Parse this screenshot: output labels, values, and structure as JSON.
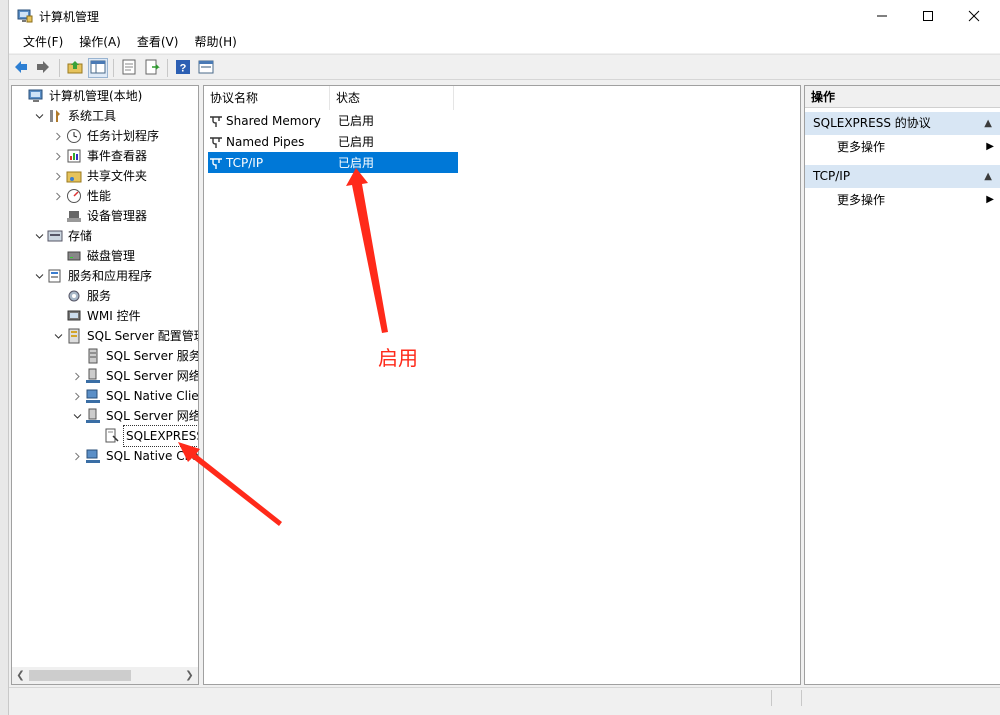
{
  "window": {
    "title": "计算机管理"
  },
  "menu": [
    "文件(F)",
    "操作(A)",
    "查看(V)",
    "帮助(H)"
  ],
  "tree": [
    {
      "label": "计算机管理(本地)",
      "level": 0,
      "expander": "",
      "icon": "computer-icon"
    },
    {
      "label": "系统工具",
      "level": 1,
      "expander": "open",
      "icon": "tools-icon"
    },
    {
      "label": "任务计划程序",
      "level": 2,
      "expander": "closed",
      "icon": "clock-icon"
    },
    {
      "label": "事件查看器",
      "level": 2,
      "expander": "closed",
      "icon": "event-viewer-icon"
    },
    {
      "label": "共享文件夹",
      "level": 2,
      "expander": "closed",
      "icon": "shared-folder-icon"
    },
    {
      "label": "性能",
      "level": 2,
      "expander": "closed",
      "icon": "performance-icon"
    },
    {
      "label": "设备管理器",
      "level": 2,
      "expander": "",
      "icon": "device-manager-icon"
    },
    {
      "label": "存储",
      "level": 1,
      "expander": "open",
      "icon": "storage-icon"
    },
    {
      "label": "磁盘管理",
      "level": 2,
      "expander": "",
      "icon": "disk-icon"
    },
    {
      "label": "服务和应用程序",
      "level": 1,
      "expander": "open",
      "icon": "services-apps-icon"
    },
    {
      "label": "服务",
      "level": 2,
      "expander": "",
      "icon": "gear-icon"
    },
    {
      "label": "WMI 控件",
      "level": 2,
      "expander": "",
      "icon": "wmi-icon"
    },
    {
      "label": "SQL Server 配置管理器",
      "level": 2,
      "expander": "open",
      "icon": "sql-config-icon"
    },
    {
      "label": "SQL Server 服务",
      "level": 3,
      "expander": "",
      "icon": "server-icon"
    },
    {
      "label": "SQL Server 网络配",
      "level": 3,
      "expander": "closed",
      "icon": "network-config-icon"
    },
    {
      "label": "SQL Native Client",
      "level": 3,
      "expander": "closed",
      "icon": "native-client-icon"
    },
    {
      "label": "SQL Server 网络配",
      "level": 3,
      "expander": "open",
      "icon": "network-config-icon"
    },
    {
      "label": "SQLEXPRESS 的",
      "level": 4,
      "expander": "",
      "icon": "protocol-folder-icon",
      "selected": true
    },
    {
      "label": "SQL Native Client",
      "level": 3,
      "expander": "closed",
      "icon": "native-client-icon"
    }
  ],
  "list": {
    "columns": [
      "协议名称",
      "状态"
    ],
    "rows": [
      {
        "name": "Shared Memory",
        "status": "已启用"
      },
      {
        "name": "Named Pipes",
        "status": "已启用"
      },
      {
        "name": "TCP/IP",
        "status": "已启用",
        "selected": true
      }
    ]
  },
  "actions": {
    "title": "操作",
    "sections": [
      {
        "label": "SQLEXPRESS 的协议",
        "items": [
          "更多操作"
        ]
      },
      {
        "label": "TCP/IP",
        "items": [
          "更多操作"
        ]
      }
    ]
  },
  "annotation": {
    "text": "启用",
    "color": "#ff2a1a"
  }
}
